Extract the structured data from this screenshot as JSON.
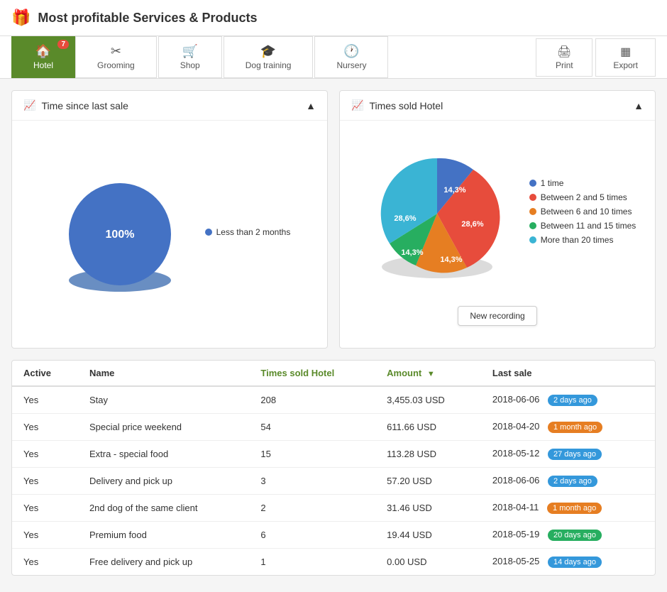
{
  "header": {
    "icon": "🎁",
    "title": "Most profitable Services & Products"
  },
  "tabs": [
    {
      "id": "hotel",
      "label": "Hotel",
      "icon": "🏠",
      "active": true,
      "badge": "7"
    },
    {
      "id": "grooming",
      "label": "Grooming",
      "icon": "✂",
      "active": false,
      "badge": null
    },
    {
      "id": "shop",
      "label": "Shop",
      "icon": "🛒",
      "active": false,
      "badge": null
    },
    {
      "id": "dog-training",
      "label": "Dog training",
      "icon": "🎓",
      "active": false,
      "badge": null
    },
    {
      "id": "nursery",
      "label": "Nursery",
      "icon": "🕐",
      "active": false,
      "badge": null
    }
  ],
  "actions": [
    {
      "id": "print",
      "label": "Print",
      "icon": "🖨"
    },
    {
      "id": "export",
      "label": "Export",
      "icon": "⊞"
    }
  ],
  "charts": {
    "left": {
      "title": "Time since last sale",
      "legend": [
        {
          "label": "Less than 2 months",
          "color": "#4472C4"
        }
      ],
      "data": [
        {
          "label": "100%",
          "value": 100,
          "color": "#4472C4"
        }
      ]
    },
    "right": {
      "title": "Times sold Hotel",
      "legend": [
        {
          "label": "1 time",
          "color": "#4472C4"
        },
        {
          "label": "Between 2 and 5 times",
          "color": "#E74C3C"
        },
        {
          "label": "Between 6 and 10 times",
          "color": "#E67E22"
        },
        {
          "label": "Between 11 and 15 times",
          "color": "#27AE60"
        },
        {
          "label": "More than 20 times",
          "color": "#3AB4D4"
        }
      ],
      "data": [
        {
          "label": "14,3%",
          "value": 14.3,
          "color": "#4472C4"
        },
        {
          "label": "28,6%",
          "value": 28.6,
          "color": "#E74C3C"
        },
        {
          "label": "14,3%",
          "value": 14.3,
          "color": "#E67E22"
        },
        {
          "label": "14,3%",
          "value": 14.3,
          "color": "#27AE60"
        },
        {
          "label": "28,6%",
          "value": 28.6,
          "color": "#3AB4D4"
        }
      ],
      "new_recording_label": "New recording"
    }
  },
  "table": {
    "columns": [
      {
        "id": "active",
        "label": "Active",
        "sorted": false
      },
      {
        "id": "name",
        "label": "Name",
        "sorted": false
      },
      {
        "id": "times_sold",
        "label": "Times sold Hotel",
        "sorted": false
      },
      {
        "id": "amount",
        "label": "Amount",
        "sorted": true
      },
      {
        "id": "last_sale",
        "label": "Last sale",
        "sorted": false
      }
    ],
    "rows": [
      {
        "active": "Yes",
        "name": "Stay",
        "times_sold": "208",
        "amount": "3,455.03 USD",
        "last_sale": "2018-06-06",
        "badge_label": "2 days ago",
        "badge_color": "blue"
      },
      {
        "active": "Yes",
        "name": "Special price weekend",
        "times_sold": "54",
        "amount": "611.66 USD",
        "last_sale": "2018-04-20",
        "badge_label": "1 month ago",
        "badge_color": "orange"
      },
      {
        "active": "Yes",
        "name": "Extra - special food",
        "times_sold": "15",
        "amount": "113.28 USD",
        "last_sale": "2018-05-12",
        "badge_label": "27 days ago",
        "badge_color": "blue"
      },
      {
        "active": "Yes",
        "name": "Delivery and pick up",
        "times_sold": "3",
        "amount": "57.20 USD",
        "last_sale": "2018-06-06",
        "badge_label": "2 days ago",
        "badge_color": "blue"
      },
      {
        "active": "Yes",
        "name": "2nd dog of the same client",
        "times_sold": "2",
        "amount": "31.46 USD",
        "last_sale": "2018-04-11",
        "badge_label": "1 month ago",
        "badge_color": "orange"
      },
      {
        "active": "Yes",
        "name": "Premium food",
        "times_sold": "6",
        "amount": "19.44 USD",
        "last_sale": "2018-05-19",
        "badge_label": "20 days ago",
        "badge_color": "green"
      },
      {
        "active": "Yes",
        "name": "Free delivery and pick up",
        "times_sold": "1",
        "amount": "0.00 USD",
        "last_sale": "2018-05-25",
        "badge_label": "14 days ago",
        "badge_color": "blue"
      }
    ]
  }
}
